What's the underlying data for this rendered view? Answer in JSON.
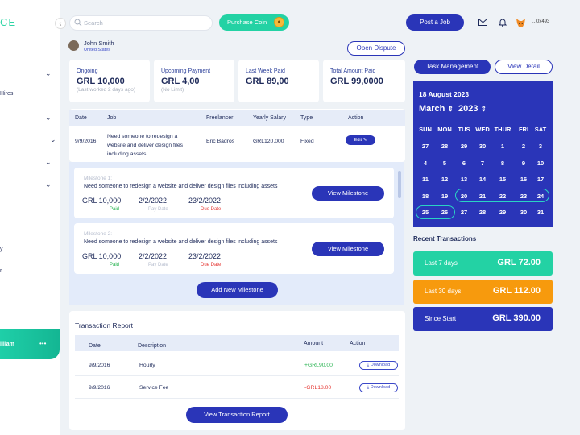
{
  "brand": {
    "logo_fragment": "CE",
    "primary": "#2a35b8",
    "accent": "#23d2a4",
    "orange": "#f79a0d"
  },
  "sidebar": {
    "items": [
      {
        "label": ""
      },
      {
        "label": "Hires"
      },
      {
        "label": ""
      },
      {
        "label": ""
      },
      {
        "label": ""
      },
      {
        "label": ""
      },
      {
        "label": "y"
      },
      {
        "label": "r"
      }
    ],
    "user_name": "illiam",
    "user_menu": "•••"
  },
  "topbar": {
    "search_placeholder": "Search",
    "purchase_coin": "Purchase Coin",
    "post_job": "Post a Job",
    "wallet_address": "...0x493"
  },
  "freelancer": {
    "name": "John Smith",
    "country": "United States",
    "open_dispute": "Open Dispute"
  },
  "stats": [
    {
      "label": "Ongoing",
      "value": "GRL 10,000",
      "sub": "(Last worked 2 days ago)"
    },
    {
      "label": "Upcoming Payment",
      "value": "GRL 4,00",
      "sub": "(No Limit)"
    },
    {
      "label": "Last Week Paid",
      "value": "GRL 89,00",
      "sub": ""
    },
    {
      "label": "Total Amount Paid",
      "value": "GRL 99,0000",
      "sub": ""
    }
  ],
  "jobs_table": {
    "headers": [
      "Date",
      "Job",
      "Freelancer",
      "Yearly Salary",
      "Type",
      "Action"
    ],
    "row": {
      "date": "9/9/2016",
      "job_line1": "Need someone to redesign a",
      "job_line2": "website and deliver design files",
      "job_line3": "including assets",
      "freelancer": "Eric Badros",
      "salary": "GRL120,000",
      "type": "Fixed",
      "action": "Edit"
    }
  },
  "milestones": [
    {
      "title": "Milestone 1:",
      "desc": "Need someone to redesign a website and deliver design files including assets",
      "amount": "GRL 10,000",
      "pay_date": "2/2/2022",
      "due_date": "23/2/2022",
      "amount_status": "Paid",
      "pay_label": "Pay Date",
      "due_label": "Due Date",
      "button": "View Milestone"
    },
    {
      "title": "Milestone 2:",
      "desc": "Need someone to redesign a website and deliver design files including assets",
      "amount": "GRL 10,000",
      "pay_date": "2/2/2022",
      "due_date": "23/2/2022",
      "amount_status": "Paid",
      "pay_label": "Pay Date",
      "due_label": "Due Date",
      "button": "View Milestone"
    }
  ],
  "add_milestone": "Add New Milestone",
  "transaction_report": {
    "title": "Transaction Report",
    "headers": [
      "Date",
      "Description",
      "Amount",
      "Action"
    ],
    "rows": [
      {
        "date": "9/9/2016",
        "description": "Hourly",
        "amount": "+GRL90.00",
        "action": "Download"
      },
      {
        "date": "9/9/2016",
        "description": "Service Fee",
        "amount": "-GRL18.00",
        "action": "Download"
      }
    ],
    "view_button": "View Transaction Report"
  },
  "right": {
    "task_management": "Task Management",
    "view_detail": "View Detail",
    "calendar": {
      "selected_date": "18 August 2023",
      "month": "March",
      "year": "2023",
      "weekdays": [
        "SUN",
        "MON",
        "TUS",
        "WED",
        "THUR",
        "FRI",
        "SAT"
      ],
      "weeks": [
        [
          "27",
          "28",
          "29",
          "30",
          "1",
          "2",
          "3"
        ],
        [
          "4",
          "5",
          "6",
          "7",
          "8",
          "9",
          "10"
        ],
        [
          "11",
          "12",
          "13",
          "14",
          "15",
          "16",
          "17"
        ],
        [
          "18",
          "19",
          "20",
          "21",
          "22",
          "23",
          "24"
        ],
        [
          "25",
          "26",
          "27",
          "28",
          "29",
          "30",
          "31"
        ]
      ]
    },
    "recent_title": "Recent Transactions",
    "recent": [
      {
        "label": "Last 7 days",
        "amount": "GRL 72.00",
        "color": "#23d2a4"
      },
      {
        "label": "Last 30 days",
        "amount": "GRL 112.00",
        "color": "#f79a0d"
      },
      {
        "label": "Since Start",
        "amount": "GRL 390.00",
        "color": "#2a35b8"
      }
    ]
  }
}
